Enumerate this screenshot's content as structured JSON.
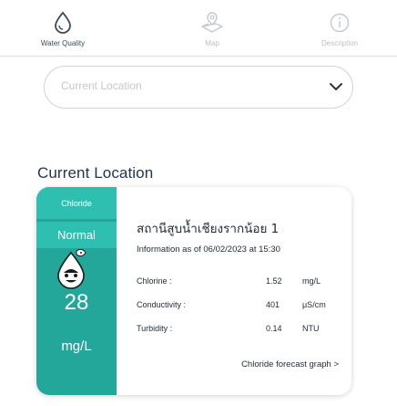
{
  "tabs": [
    {
      "label": "Water Quality",
      "icon": "water-drop-icon",
      "active": true
    },
    {
      "label": "Map",
      "icon": "map-pin-icon",
      "active": false
    },
    {
      "label": "Description",
      "icon": "info-icon",
      "active": false
    }
  ],
  "location_select": {
    "placeholder": "Current Location",
    "icon": "chevron-down-icon"
  },
  "section_title": "Current Location",
  "card": {
    "parameter": "Chloride",
    "status": "Normal",
    "status_icon": "happy-drop-icon",
    "value": "28",
    "unit": "mg/L",
    "station_name": "สถานีสูบน้ำเชียงรากน้อย 1",
    "info_line": "Information as of 06/02/2023 at 15:30",
    "rows": [
      {
        "param": "Chlorine :",
        "value": "1.52",
        "unit": "mg/L"
      },
      {
        "param": "Conductivity :",
        "value": "401",
        "unit": "μS/cm"
      },
      {
        "param": "Turbidity :",
        "value": "0.14",
        "unit": "NTU"
      }
    ],
    "graph_link": "Chloride forecast graph >"
  },
  "colors": {
    "accent_teal": "#23a79b",
    "chip_teal": "#2fbfb1",
    "text_dark": "#1f2a3a",
    "inactive": "#b9bec7"
  }
}
